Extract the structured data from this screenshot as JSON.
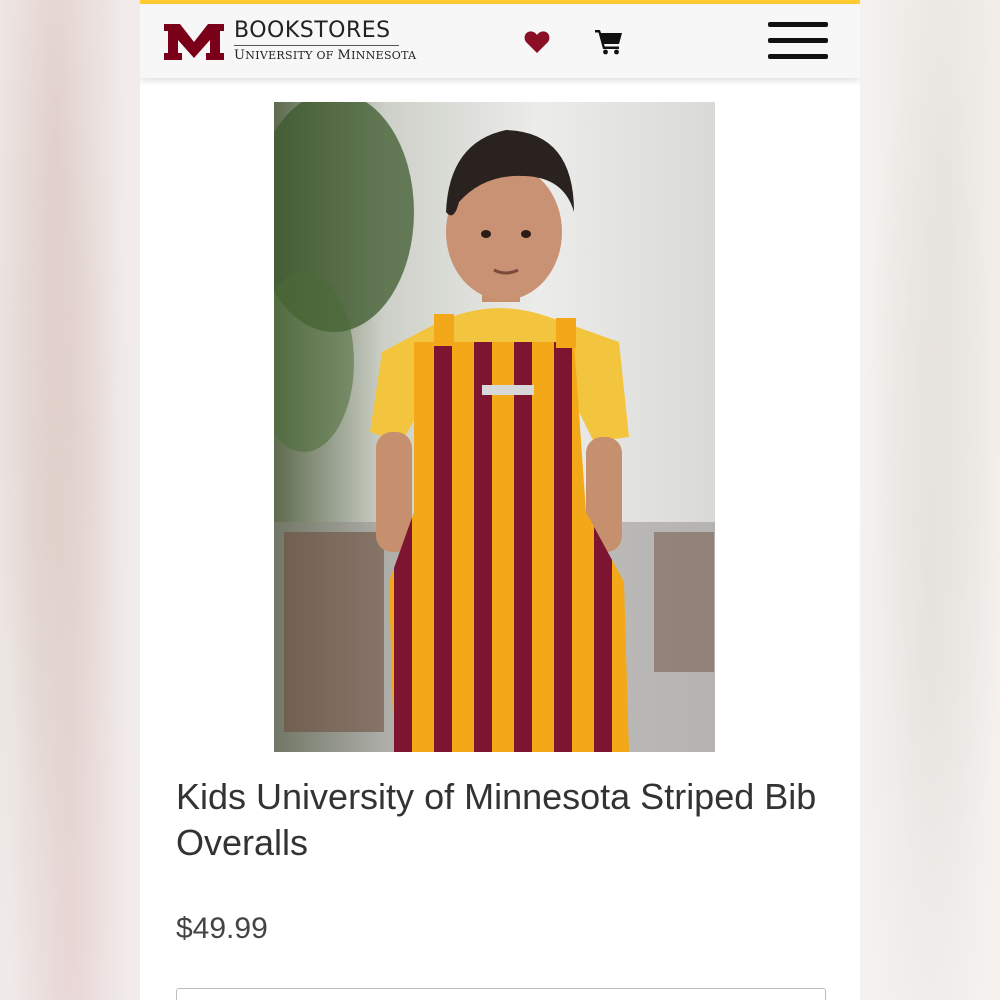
{
  "header": {
    "logo_top": "BOOKSTORES",
    "logo_bottom_prefix_u": "U",
    "logo_bottom_niversity": "NIVERSITY OF ",
    "logo_bottom_m": "M",
    "logo_bottom_innesota": "INNESOTA",
    "icons": {
      "wishlist": "heart-icon",
      "cart": "cart-icon",
      "menu": "hamburger-menu-icon"
    }
  },
  "product": {
    "image_alt": "Kids University of Minnesota Striped Bib Overalls",
    "title": "Kids University of Minnesota Striped Bib Overalls",
    "price": "$49.99"
  },
  "colors": {
    "brand_maroon": "#7a0019",
    "brand_gold": "#ffcc33",
    "text": "#333333"
  }
}
